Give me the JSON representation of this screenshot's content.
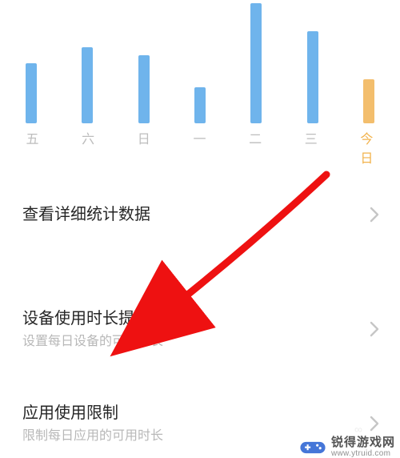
{
  "chart_data": {
    "type": "bar",
    "categories": [
      "五",
      "六",
      "日",
      "一",
      "二",
      "三",
      "今日"
    ],
    "values": [
      75,
      95,
      85,
      45,
      150,
      115,
      55
    ],
    "today_index": 6,
    "title": "",
    "xlabel": "",
    "ylabel": "",
    "ylim": [
      0,
      150
    ],
    "colors": {
      "bar": "#6fb4ec",
      "today_bar": "#f3be6d",
      "tick": "#bdbdbd",
      "today_tick": "#f2b24b"
    }
  },
  "items": {
    "stats": {
      "title": "查看详细统计数据"
    },
    "device": {
      "title": "设备使用时长提醒",
      "sub": "设置每日设备的可用时长"
    },
    "applimit": {
      "title": "应用使用限制",
      "sub": "限制每日应用的可用时长"
    }
  },
  "watermark": {
    "line1": "锐得游戏网",
    "line2": "www.ytruid.com"
  },
  "ghost_text": "∞"
}
